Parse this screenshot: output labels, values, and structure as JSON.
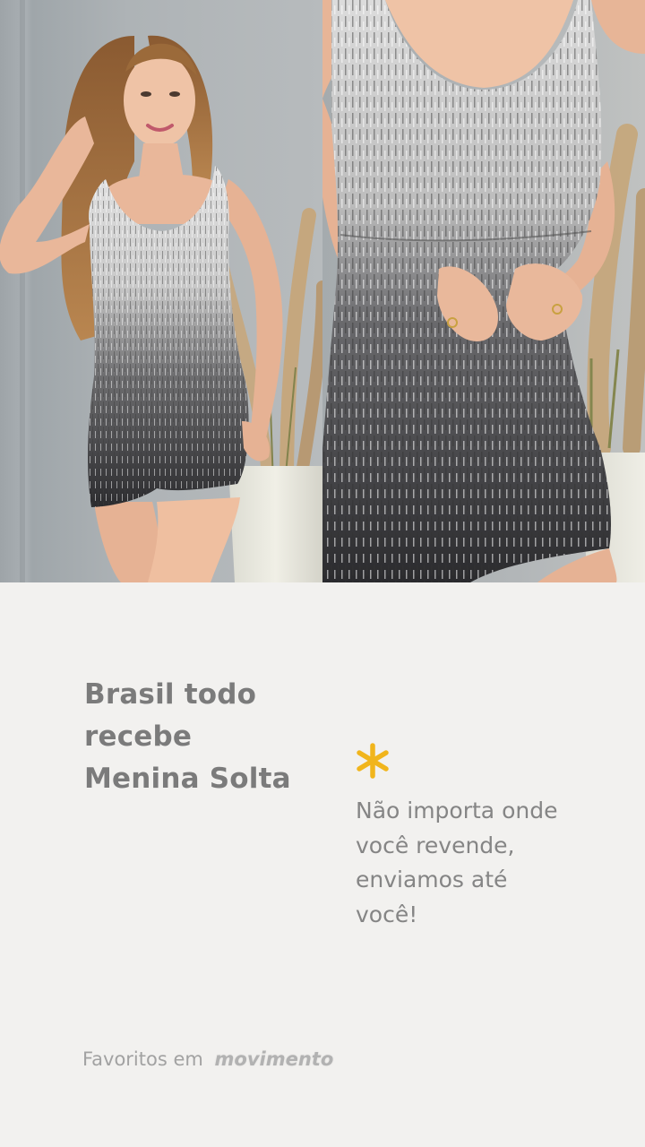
{
  "headline": {
    "lines": [
      "Brasil todo",
      "recebe",
      "Menina Solta"
    ]
  },
  "body": {
    "lines": [
      "Não importa onde",
      "você revende,",
      "enviamos até",
      "você!"
    ]
  },
  "footer": {
    "text": "Favoritos em",
    "brand": "movimento"
  },
  "icons": {
    "asterisk": "asterisk-icon"
  },
  "colors": {
    "background": "#f2f1ef",
    "headline": "#7b7b7b",
    "body_text": "#858585",
    "accent": "#f1b51c"
  }
}
